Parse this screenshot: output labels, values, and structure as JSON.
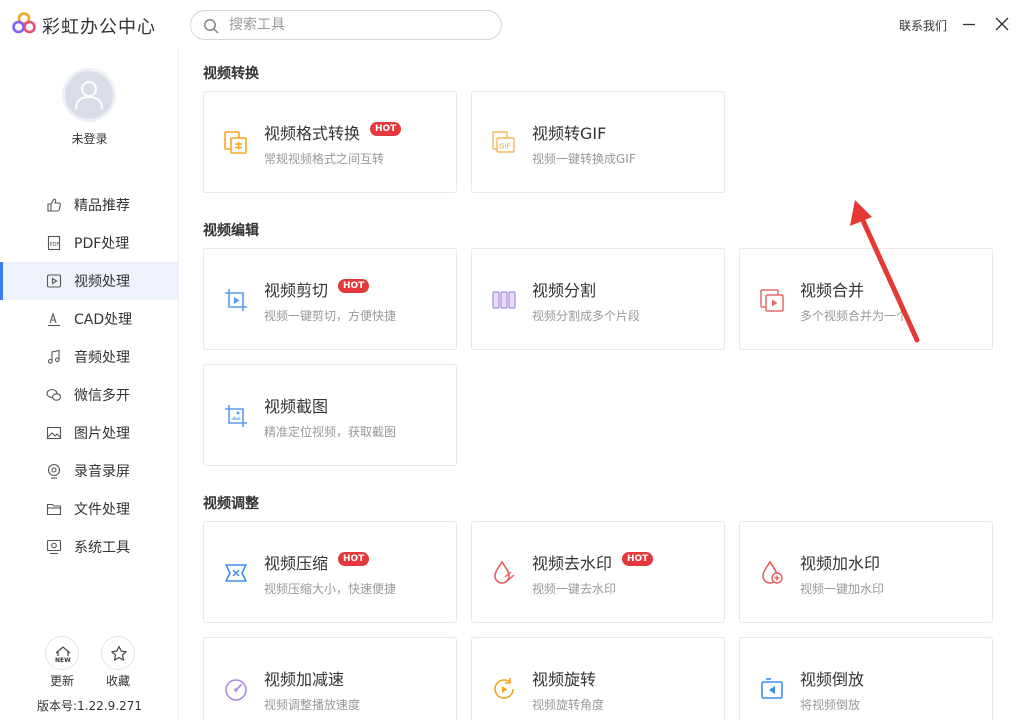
{
  "app": {
    "title": "彩虹办公中心"
  },
  "search": {
    "placeholder": "搜索工具"
  },
  "header": {
    "contact": "联系我们"
  },
  "user": {
    "status": "未登录"
  },
  "sidebar": {
    "items": [
      {
        "label": "精品推荐",
        "icon": "thumbs-up-icon"
      },
      {
        "label": "PDF处理",
        "icon": "pdf-icon"
      },
      {
        "label": "视频处理",
        "icon": "video-play-icon",
        "active": true
      },
      {
        "label": "CAD处理",
        "icon": "cad-icon"
      },
      {
        "label": "音频处理",
        "icon": "music-note-icon"
      },
      {
        "label": "微信多开",
        "icon": "wechat-icon"
      },
      {
        "label": "图片处理",
        "icon": "image-icon"
      },
      {
        "label": "录音录屏",
        "icon": "record-icon"
      },
      {
        "label": "文件处理",
        "icon": "folder-icon"
      },
      {
        "label": "系统工具",
        "icon": "system-tool-icon"
      }
    ],
    "update_label": "更新",
    "update_badge": "NEW",
    "favorite_label": "收藏",
    "version": "版本号:1.22.9.271"
  },
  "sections": {
    "convert": {
      "title": "视频转换",
      "cards": [
        {
          "title": "视频格式转换",
          "hot": "HOT",
          "desc": "常规视频格式之间互转",
          "icon": "video-format-icon"
        },
        {
          "title": "视频转GIF",
          "desc": "视频一键转换成GIF",
          "icon": "gif-icon"
        }
      ]
    },
    "edit": {
      "title": "视频编辑",
      "cards": [
        {
          "title": "视频剪切",
          "hot": "HOT",
          "desc": "视频一键剪切，方便快捷",
          "icon": "crop-play-icon"
        },
        {
          "title": "视频分割",
          "desc": "视频分割成多个片段",
          "icon": "split-icon"
        },
        {
          "title": "视频合并",
          "desc": "多个视频合并为一个",
          "icon": "merge-icon"
        },
        {
          "title": "视频截图",
          "desc": "精准定位视频，获取截图",
          "icon": "screenshot-icon"
        }
      ]
    },
    "adjust": {
      "title": "视频调整",
      "cards": [
        {
          "title": "视频压缩",
          "hot": "HOT",
          "desc": "视频压缩大小，快速便捷",
          "icon": "compress-icon"
        },
        {
          "title": "视频去水印",
          "hot": "HOT",
          "desc": "视频一键去水印",
          "icon": "remove-watermark-icon"
        },
        {
          "title": "视频加水印",
          "desc": "视频一键加水印",
          "icon": "add-watermark-icon"
        },
        {
          "title": "视频加减速",
          "desc": "视频调整播放速度",
          "icon": "speed-gauge-icon"
        },
        {
          "title": "视频旋转",
          "desc": "视频旋转角度",
          "icon": "rotate-icon"
        },
        {
          "title": "视频倒放",
          "desc": "将视频倒放",
          "icon": "reverse-icon"
        }
      ]
    }
  },
  "colors": {
    "accent": "#3b7cf6",
    "hot": "#e4393c",
    "arrow": "#e53935"
  }
}
